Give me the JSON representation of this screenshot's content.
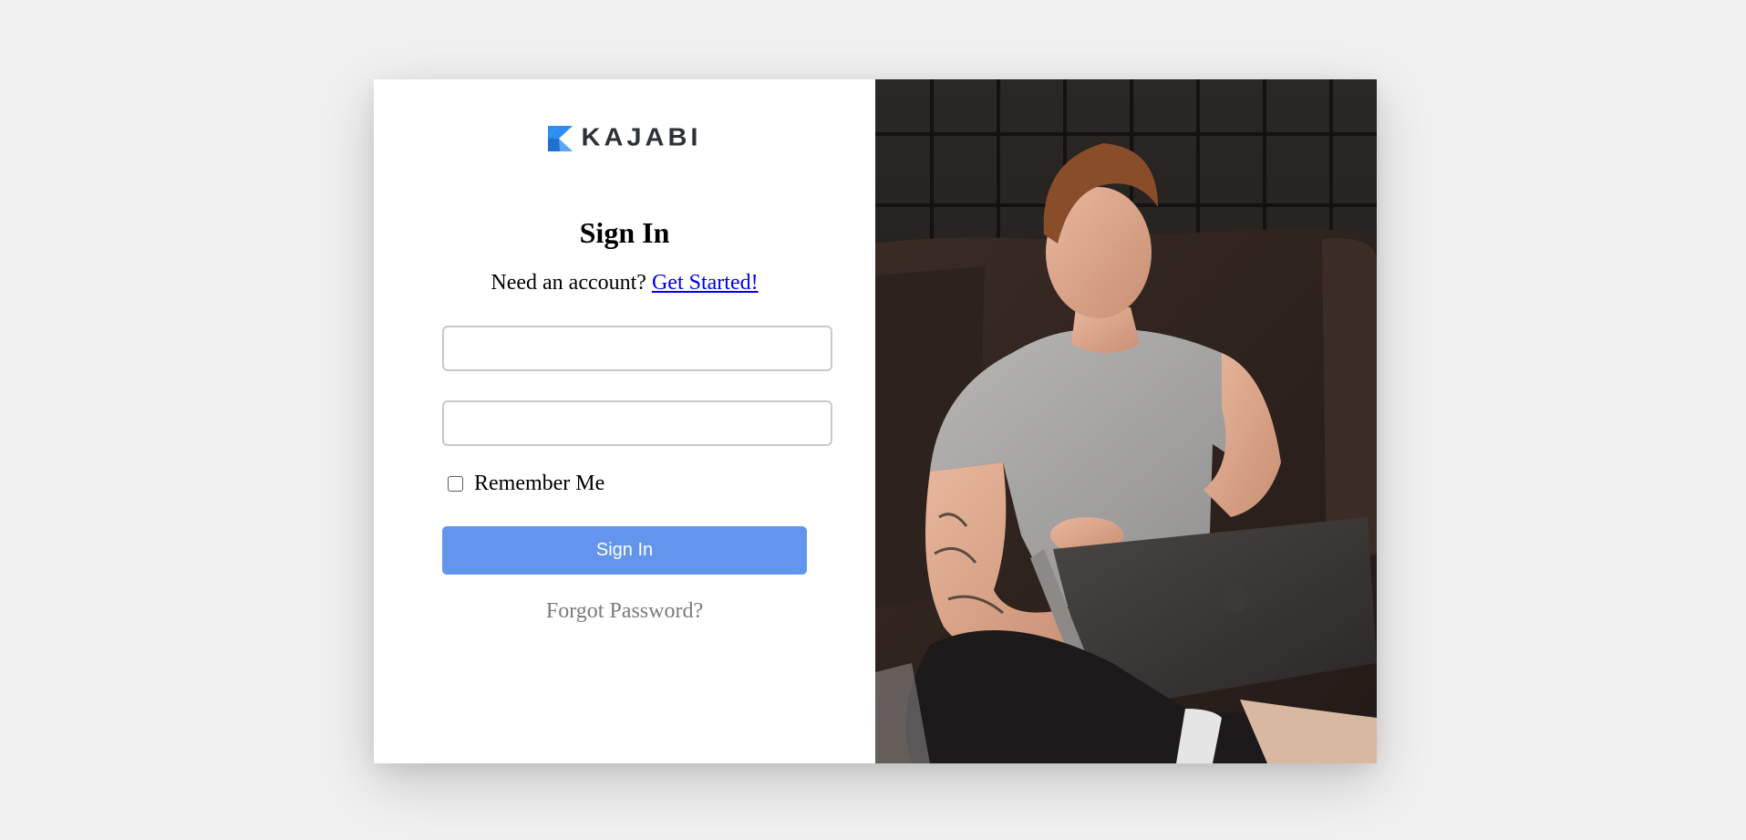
{
  "brand": {
    "name": "KAJABI",
    "accent": "#2d8cf5",
    "dark": "#2d3138"
  },
  "signin": {
    "title": "Sign In",
    "prompt": "Need an account?",
    "get_started": "Get Started!",
    "email_value": "",
    "password_value": "",
    "remember_label": "Remember Me",
    "remember_checked": false,
    "button_label": "Sign In",
    "button_color": "#6495ed",
    "forgot_label": "Forgot Password?"
  },
  "hero_image": {
    "subject": "smiling man in grey t-shirt using a laptop on a dark leather couch",
    "icon": "photo"
  }
}
